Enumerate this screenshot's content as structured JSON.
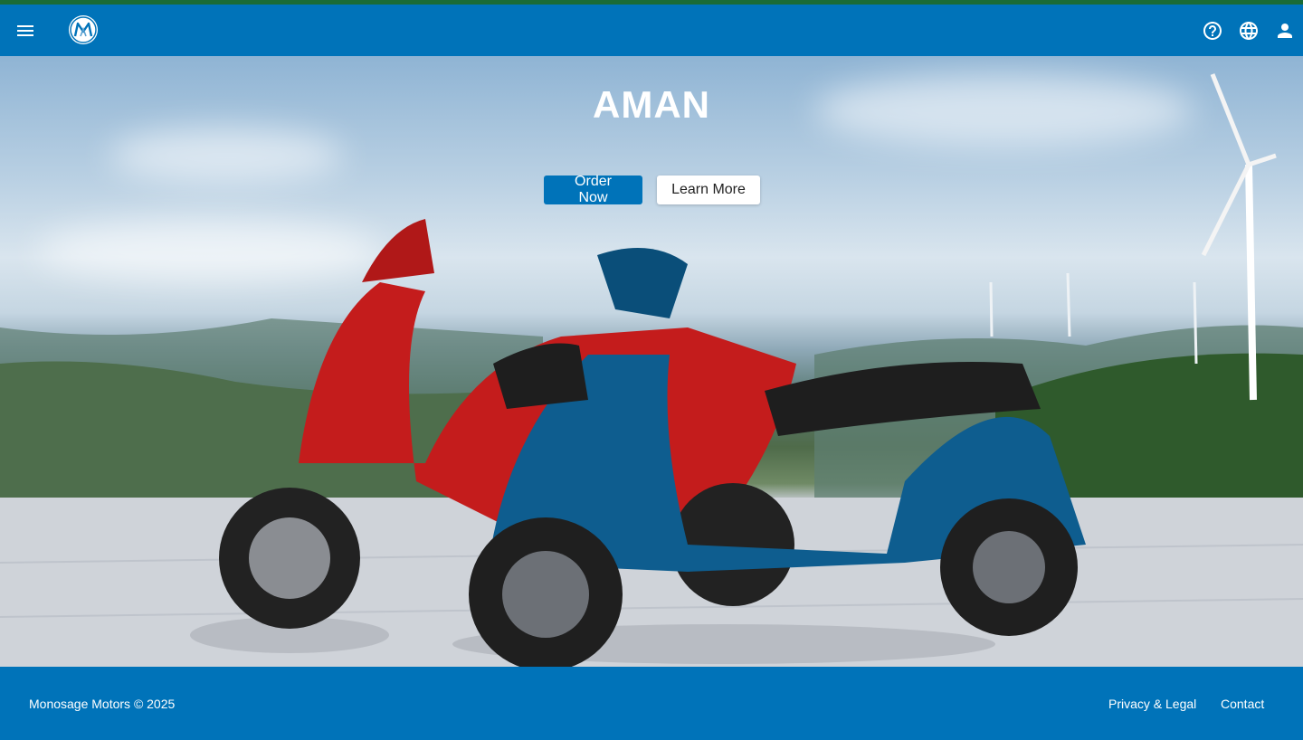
{
  "header": {
    "menu_icon": "menu-icon",
    "logo_icon": "brand-logo",
    "help_icon": "help-icon",
    "language_icon": "globe-icon",
    "account_icon": "person-icon"
  },
  "hero": {
    "title": "AMAN",
    "order_label": "Order Now",
    "learn_label": "Learn More"
  },
  "footer": {
    "copyright": "Monosage Motors © 2025",
    "links": [
      "Privacy & Legal",
      "Contact"
    ]
  },
  "colors": {
    "brand_blue": "#0073b9",
    "accent_green": "#1a6b35",
    "white": "#ffffff"
  }
}
